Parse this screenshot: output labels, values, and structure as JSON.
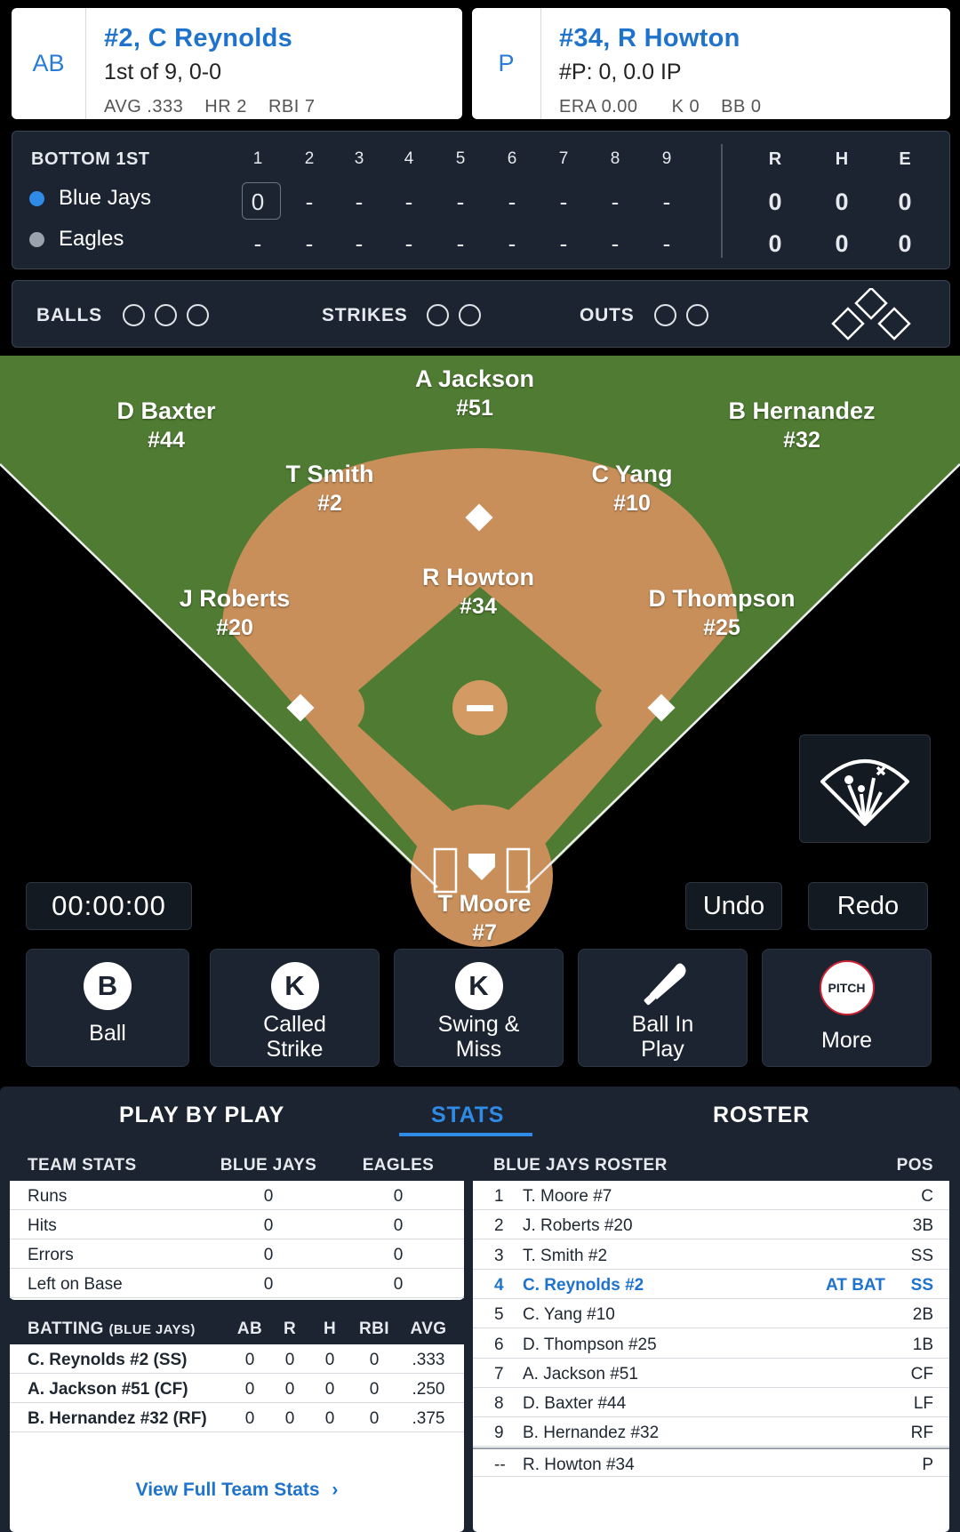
{
  "at_bat_card": {
    "tag": "AB",
    "name": "#2, C Reynolds",
    "line2": "1st of 9, 0-0",
    "stats": [
      "AVG .333",
      "HR 2",
      "RBI 7"
    ]
  },
  "pitcher_card": {
    "tag": "P",
    "name": "#34, R Howton",
    "line2": "#P: 0, 0.0 IP",
    "stats": [
      "ERA 0.00",
      "K 0",
      "BB 0"
    ]
  },
  "scoreboard": {
    "inning": "BOTTOM 1ST",
    "innings": [
      "1",
      "2",
      "3",
      "4",
      "5",
      "6",
      "7",
      "8",
      "9"
    ],
    "totals_headers": [
      "R",
      "H",
      "E"
    ],
    "teams": [
      {
        "name": "Blue Jays",
        "color": "#2f8be6",
        "innings": [
          "0",
          "-",
          "-",
          "-",
          "-",
          "-",
          "-",
          "-",
          "-"
        ],
        "totals": [
          "0",
          "0",
          "0"
        ]
      },
      {
        "name": "Eagles",
        "color": "#9aa3ad",
        "innings": [
          "-",
          "-",
          "-",
          "-",
          "-",
          "-",
          "-",
          "-",
          "-"
        ],
        "totals": [
          "0",
          "0",
          "0"
        ]
      }
    ]
  },
  "count": {
    "balls_label": "BALLS",
    "strikes_label": "STRIKES",
    "outs_label": "OUTS",
    "balls": 0,
    "strikes": 0,
    "outs": 0
  },
  "fielders": [
    {
      "name": "A Jackson",
      "num": "#51"
    },
    {
      "name": "D Baxter",
      "num": "#44"
    },
    {
      "name": "B Hernandez",
      "num": "#32"
    },
    {
      "name": "T Smith",
      "num": "#2"
    },
    {
      "name": "C Yang",
      "num": "#10"
    },
    {
      "name": "R Howton",
      "num": "#34"
    },
    {
      "name": "J Roberts",
      "num": "#20"
    },
    {
      "name": "D Thompson",
      "num": "#25"
    },
    {
      "name": "T Moore",
      "num": "#7"
    }
  ],
  "controls": {
    "timer": "00:00:00",
    "undo": "Undo",
    "redo": "Redo",
    "spray_icon": "spray-chart-icon"
  },
  "actions": [
    {
      "icon_text": "B",
      "label": "Ball"
    },
    {
      "icon_text": "K",
      "label_l1": "Called",
      "label_l2": "Strike"
    },
    {
      "icon_text": "K",
      "label_l1": "Swing &",
      "label_l2": "Miss"
    },
    {
      "icon": "bat-icon",
      "label_l1": "Ball In",
      "label_l2": "Play"
    },
    {
      "icon_text": "PITCH",
      "label": "More"
    }
  ],
  "tabs": [
    "PLAY BY PLAY",
    "STATS",
    "ROSTER"
  ],
  "team_stats": {
    "title": "TEAM STATS",
    "cols": [
      "BLUE JAYS",
      "EAGLES"
    ],
    "rows": [
      {
        "label": "Runs",
        "a": "0",
        "b": "0"
      },
      {
        "label": "Hits",
        "a": "0",
        "b": "0"
      },
      {
        "label": "Errors",
        "a": "0",
        "b": "0"
      },
      {
        "label": "Left on Base",
        "a": "0",
        "b": "0"
      }
    ]
  },
  "batting": {
    "title": "BATTING",
    "subtitle": "(BLUE JAYS)",
    "cols": [
      "AB",
      "R",
      "H",
      "RBI",
      "AVG"
    ],
    "rows": [
      {
        "name": "C. Reynolds #2 (SS)",
        "v": [
          "0",
          "0",
          "0",
          "0",
          ".333"
        ]
      },
      {
        "name": "A. Jackson #51 (CF)",
        "v": [
          "0",
          "0",
          "0",
          "0",
          ".250"
        ]
      },
      {
        "name": "B. Hernandez #32 (RF)",
        "v": [
          "0",
          "0",
          "0",
          "0",
          ".375"
        ]
      }
    ],
    "link": "View Full Team Stats"
  },
  "roster": {
    "title": "BLUE JAYS ROSTER",
    "pos_header": "POS",
    "at_bat_label": "AT BAT",
    "rows": [
      {
        "n": "1",
        "name": "T. Moore #7",
        "pos": "C"
      },
      {
        "n": "2",
        "name": "J. Roberts #20",
        "pos": "3B"
      },
      {
        "n": "3",
        "name": "T. Smith #2",
        "pos": "SS"
      },
      {
        "n": "4",
        "name": "C. Reynolds #2",
        "pos": "SS"
      },
      {
        "n": "5",
        "name": "C. Yang #10",
        "pos": "2B"
      },
      {
        "n": "6",
        "name": "D. Thompson #25",
        "pos": "1B"
      },
      {
        "n": "7",
        "name": "A. Jackson #51",
        "pos": "CF"
      },
      {
        "n": "8",
        "name": "D. Baxter #44",
        "pos": "LF"
      },
      {
        "n": "9",
        "name": "B. Hernandez #32",
        "pos": "RF"
      },
      {
        "n": "--",
        "name": "R. Howton #34",
        "pos": "P"
      }
    ]
  }
}
